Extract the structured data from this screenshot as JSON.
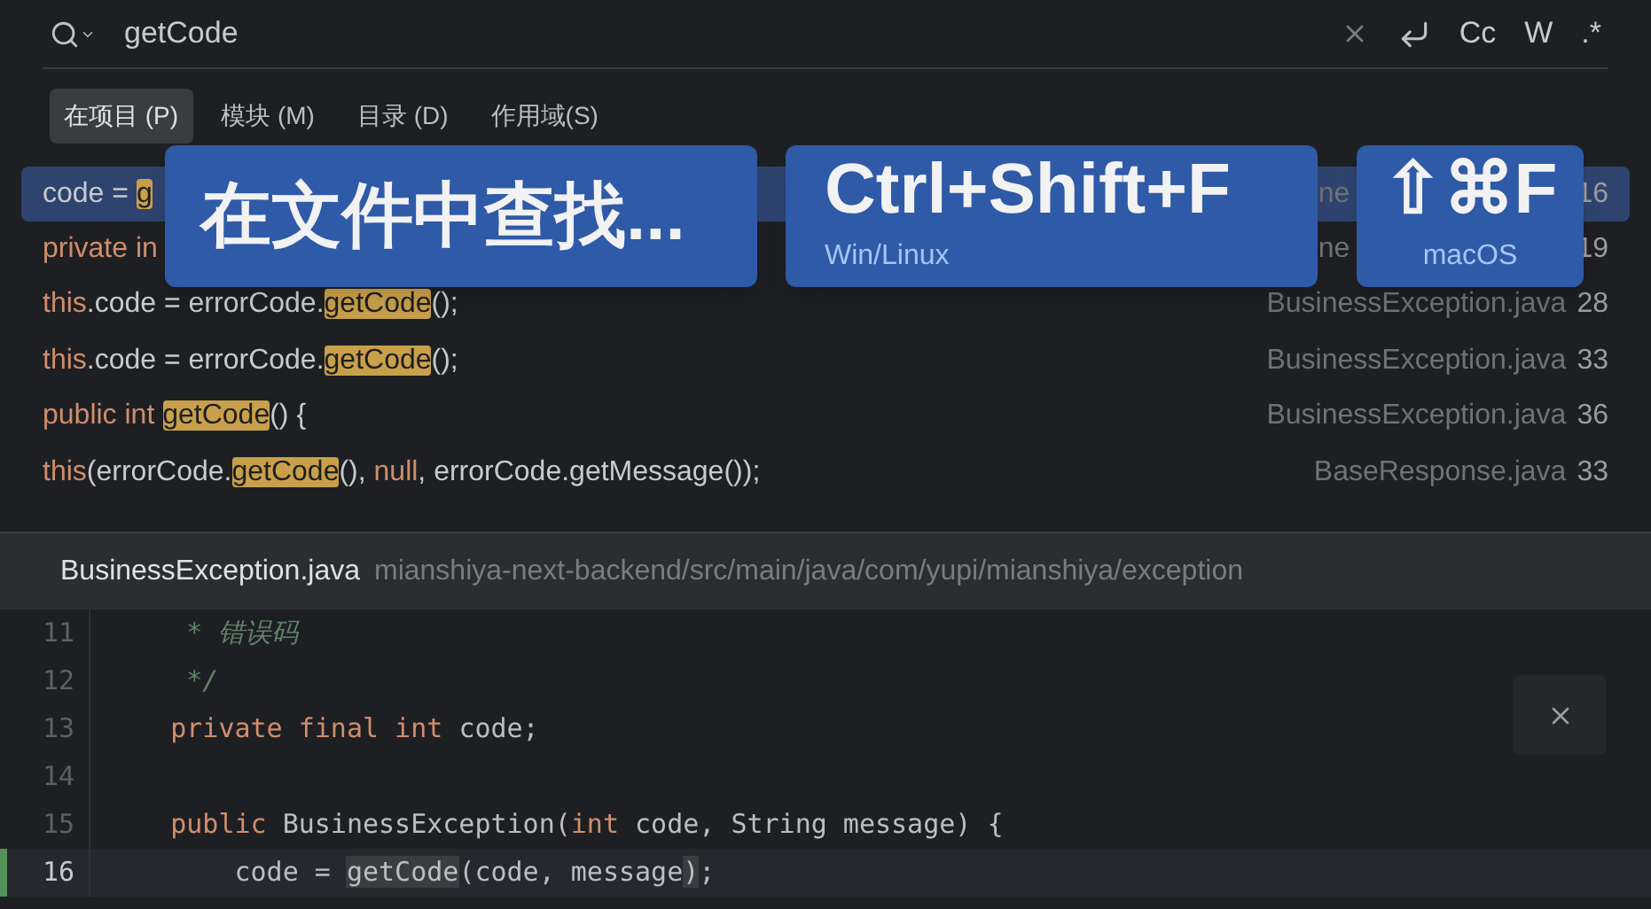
{
  "search": {
    "value": "getCode",
    "options": [
      "Cc",
      "W",
      ".*"
    ]
  },
  "scopes": [
    {
      "label": "在项目 (P)",
      "selected": true
    },
    {
      "label": "模块 (M)",
      "selected": false
    },
    {
      "label": "目录 (D)",
      "selected": false
    },
    {
      "label": "作用域(S)",
      "selected": false
    }
  ],
  "results": [
    {
      "kind": "covered",
      "selected": true,
      "tokens": [
        {
          "text": "code = ",
          "kind": "plain"
        },
        {
          "text": "g",
          "kind": "match"
        }
      ],
      "file": "ne",
      "line": "16"
    },
    {
      "kind": "covered",
      "selected": false,
      "tokens": [
        {
          "text": "private in",
          "kind": "keyword"
        }
      ],
      "file": "ne",
      "line": "19"
    },
    {
      "kind": "full",
      "selected": false,
      "tokens": [
        {
          "text": "this",
          "kind": "keyword"
        },
        {
          "text": ".code = errorCode.",
          "kind": "plain"
        },
        {
          "text": "getCode",
          "kind": "match"
        },
        {
          "text": "();",
          "kind": "plain"
        }
      ],
      "file": "BusinessException.java",
      "line": "28"
    },
    {
      "kind": "full",
      "selected": false,
      "tokens": [
        {
          "text": "this",
          "kind": "keyword"
        },
        {
          "text": ".code = errorCode.",
          "kind": "plain"
        },
        {
          "text": "getCode",
          "kind": "match"
        },
        {
          "text": "();",
          "kind": "plain"
        }
      ],
      "file": "BusinessException.java",
      "line": "33"
    },
    {
      "kind": "full",
      "selected": false,
      "tokens": [
        {
          "text": "public int ",
          "kind": "keyword"
        },
        {
          "text": "getCode",
          "kind": "match"
        },
        {
          "text": "() {",
          "kind": "plain"
        }
      ],
      "file": "BusinessException.java",
      "line": "36"
    },
    {
      "kind": "full",
      "selected": false,
      "tokens": [
        {
          "text": "this",
          "kind": "keyword"
        },
        {
          "text": "(errorCode.",
          "kind": "plain"
        },
        {
          "text": "getCode",
          "kind": "match"
        },
        {
          "text": "(), ",
          "kind": "plain"
        },
        {
          "text": "null",
          "kind": "keyword"
        },
        {
          "text": ", errorCode.getMessage());",
          "kind": "plain"
        }
      ],
      "file": "BaseResponse.java",
      "line": "33"
    }
  ],
  "overlays": [
    {
      "title": "在文件中查找..."
    },
    {
      "title": "Ctrl+Shift+F",
      "caption": "Win/Linux"
    },
    {
      "title": "⇧⌘F",
      "caption": "macOS"
    }
  ],
  "preview": {
    "file": "BusinessException.java",
    "path": "mianshiya-next-backend/src/main/java/com/yupi/mianshiya/exception"
  },
  "code_lines": [
    {
      "number": "11",
      "current": false,
      "tokens": [
        {
          "text": "     * 错误码",
          "kind": "comment"
        }
      ]
    },
    {
      "number": "12",
      "current": false,
      "tokens": [
        {
          "text": "     */",
          "kind": "comment"
        }
      ]
    },
    {
      "number": "13",
      "current": false,
      "tokens": [
        {
          "text": "    private final int ",
          "kind": "keyword"
        },
        {
          "text": "code;",
          "kind": "plain"
        }
      ]
    },
    {
      "number": "14",
      "current": false
    },
    {
      "number": "15",
      "current": false,
      "tokens": [
        {
          "text": "    public ",
          "kind": "keyword"
        },
        {
          "text": "BusinessException(",
          "kind": "plain"
        },
        {
          "text": "int ",
          "kind": "keyword"
        },
        {
          "text": "code, String message) {",
          "kind": "plain"
        }
      ]
    },
    {
      "number": "16",
      "current": true,
      "tokens": [
        {
          "text": "        code = ",
          "kind": "plain"
        },
        {
          "text": "getCode",
          "kind": "match"
        },
        {
          "text": "(code, message",
          "kind": "plain"
        },
        {
          "text": ")",
          "kind": "match"
        },
        {
          "text": ";",
          "kind": "plain"
        }
      ]
    }
  ]
}
